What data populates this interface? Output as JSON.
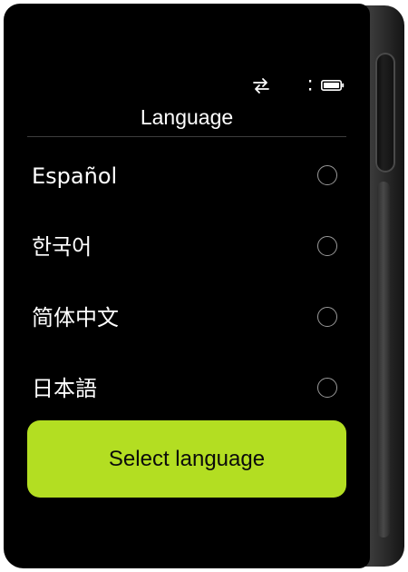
{
  "status_bar": {
    "icons": [
      "swap-arrows-icon",
      "signal-icon",
      "battery-icon"
    ]
  },
  "screen": {
    "title": "Language"
  },
  "languages": [
    {
      "label": "Español",
      "selected": false
    },
    {
      "label": "한국어",
      "selected": false
    },
    {
      "label": "简体中文",
      "selected": false
    },
    {
      "label": "日本語",
      "selected": false
    }
  ],
  "action": {
    "select_label": "Select language"
  },
  "colors": {
    "background": "#000000",
    "accent": "#b3de22",
    "text": "#ffffff",
    "radio_border": "#9a9a9a",
    "divider": "#3d3d3d"
  }
}
